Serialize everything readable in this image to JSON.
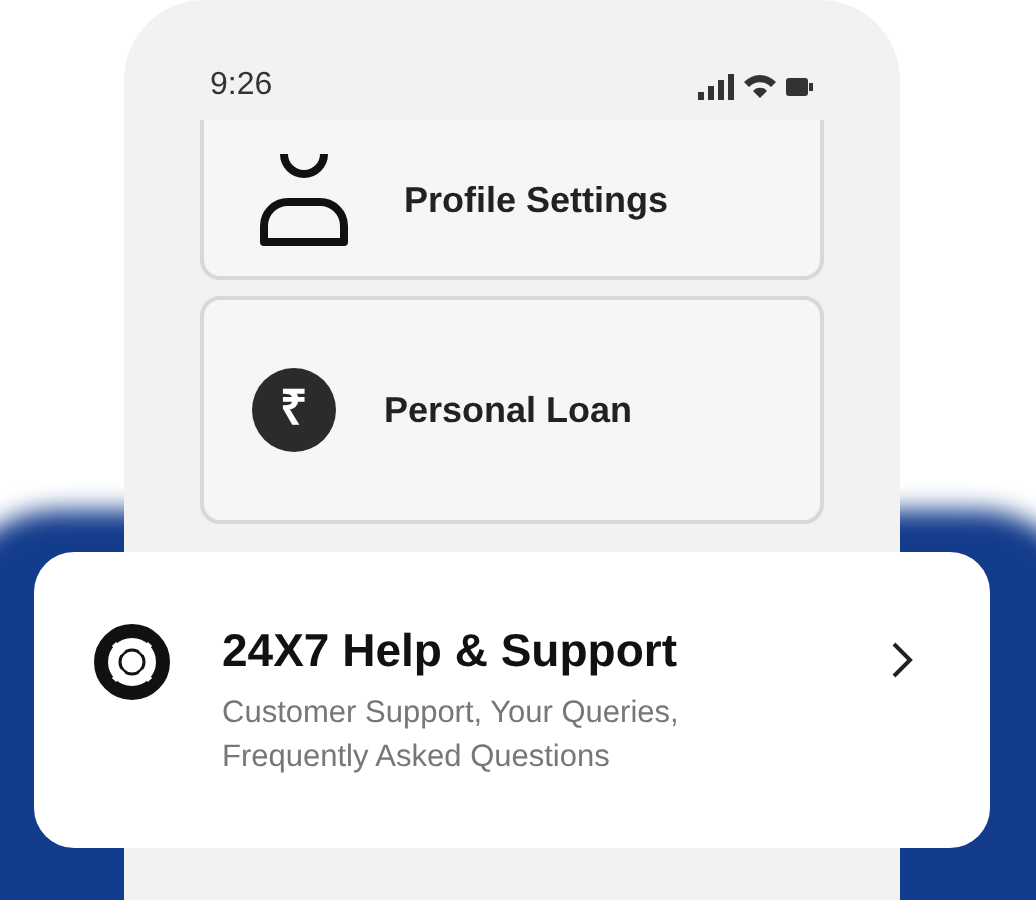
{
  "status_bar": {
    "time": "9:26"
  },
  "menu": [
    {
      "kind": "profile",
      "label": "Profile Settings"
    },
    {
      "kind": "loan",
      "label": "Personal Loan",
      "symbol": "₹"
    }
  ],
  "help_card": {
    "title": "24X7 Help & Support",
    "subtitle": "Customer Support, Your Queries, Frequently Asked Questions"
  }
}
